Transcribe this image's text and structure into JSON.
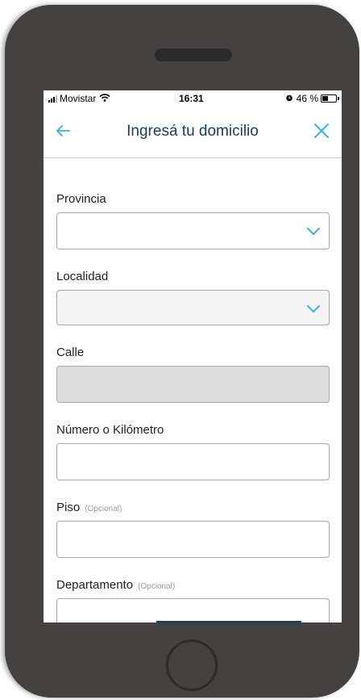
{
  "status_bar": {
    "carrier": "Movistar",
    "time": "16:31",
    "battery_percent_label": "46 %",
    "battery_level": 0.46
  },
  "nav": {
    "title": "Ingresá tu domicilio",
    "back_icon": "arrow-left-icon",
    "close_icon": "close-icon"
  },
  "form": {
    "provincia": {
      "label": "Provincia",
      "value": ""
    },
    "localidad": {
      "label": "Localidad",
      "value": ""
    },
    "calle": {
      "label": "Calle",
      "value": ""
    },
    "numero": {
      "label": "Número o Kilómetro",
      "value": ""
    },
    "piso": {
      "label": "Piso",
      "optional": "(Opcional)",
      "value": ""
    },
    "departamento": {
      "label": "Departamento",
      "optional": "(Opcional)",
      "value": ""
    }
  },
  "colors": {
    "accent": "#3ab0e0",
    "title": "#1b3a5c",
    "phone_body": "#434241"
  }
}
